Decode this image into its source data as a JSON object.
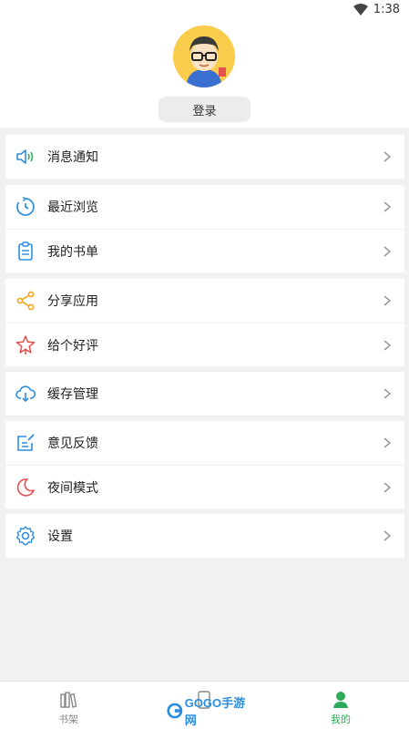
{
  "status_bar": {
    "time": "1:38"
  },
  "profile": {
    "login_label": "登录"
  },
  "menu_groups": [
    {
      "items": [
        {
          "label": "消息通知",
          "icon": "speaker-icon"
        }
      ]
    },
    {
      "items": [
        {
          "label": "最近浏览",
          "icon": "clock-icon"
        },
        {
          "label": "我的书单",
          "icon": "clipboard-icon"
        }
      ]
    },
    {
      "items": [
        {
          "label": "分享应用",
          "icon": "share-icon"
        },
        {
          "label": "给个好评",
          "icon": "star-icon"
        }
      ]
    },
    {
      "items": [
        {
          "label": "缓存管理",
          "icon": "cloud-download-icon"
        }
      ]
    },
    {
      "items": [
        {
          "label": "意见反馈",
          "icon": "edit-icon"
        },
        {
          "label": "夜间模式",
          "icon": "moon-icon"
        }
      ]
    },
    {
      "items": [
        {
          "label": "设置",
          "icon": "gear-icon"
        }
      ]
    }
  ],
  "tabbar": {
    "tabs": [
      {
        "label": "书架",
        "icon": "bookshelf-icon"
      },
      {
        "label": "",
        "icon": "phone-icon"
      },
      {
        "label": "我的",
        "icon": "user-icon",
        "active": true
      }
    ]
  },
  "watermark": {
    "text": "GOGO手游网"
  },
  "colors": {
    "accent_green": "#2eaa5a",
    "icon_blue": "#2a8de0",
    "icon_orange": "#f5a623",
    "icon_red": "#e8504f"
  }
}
